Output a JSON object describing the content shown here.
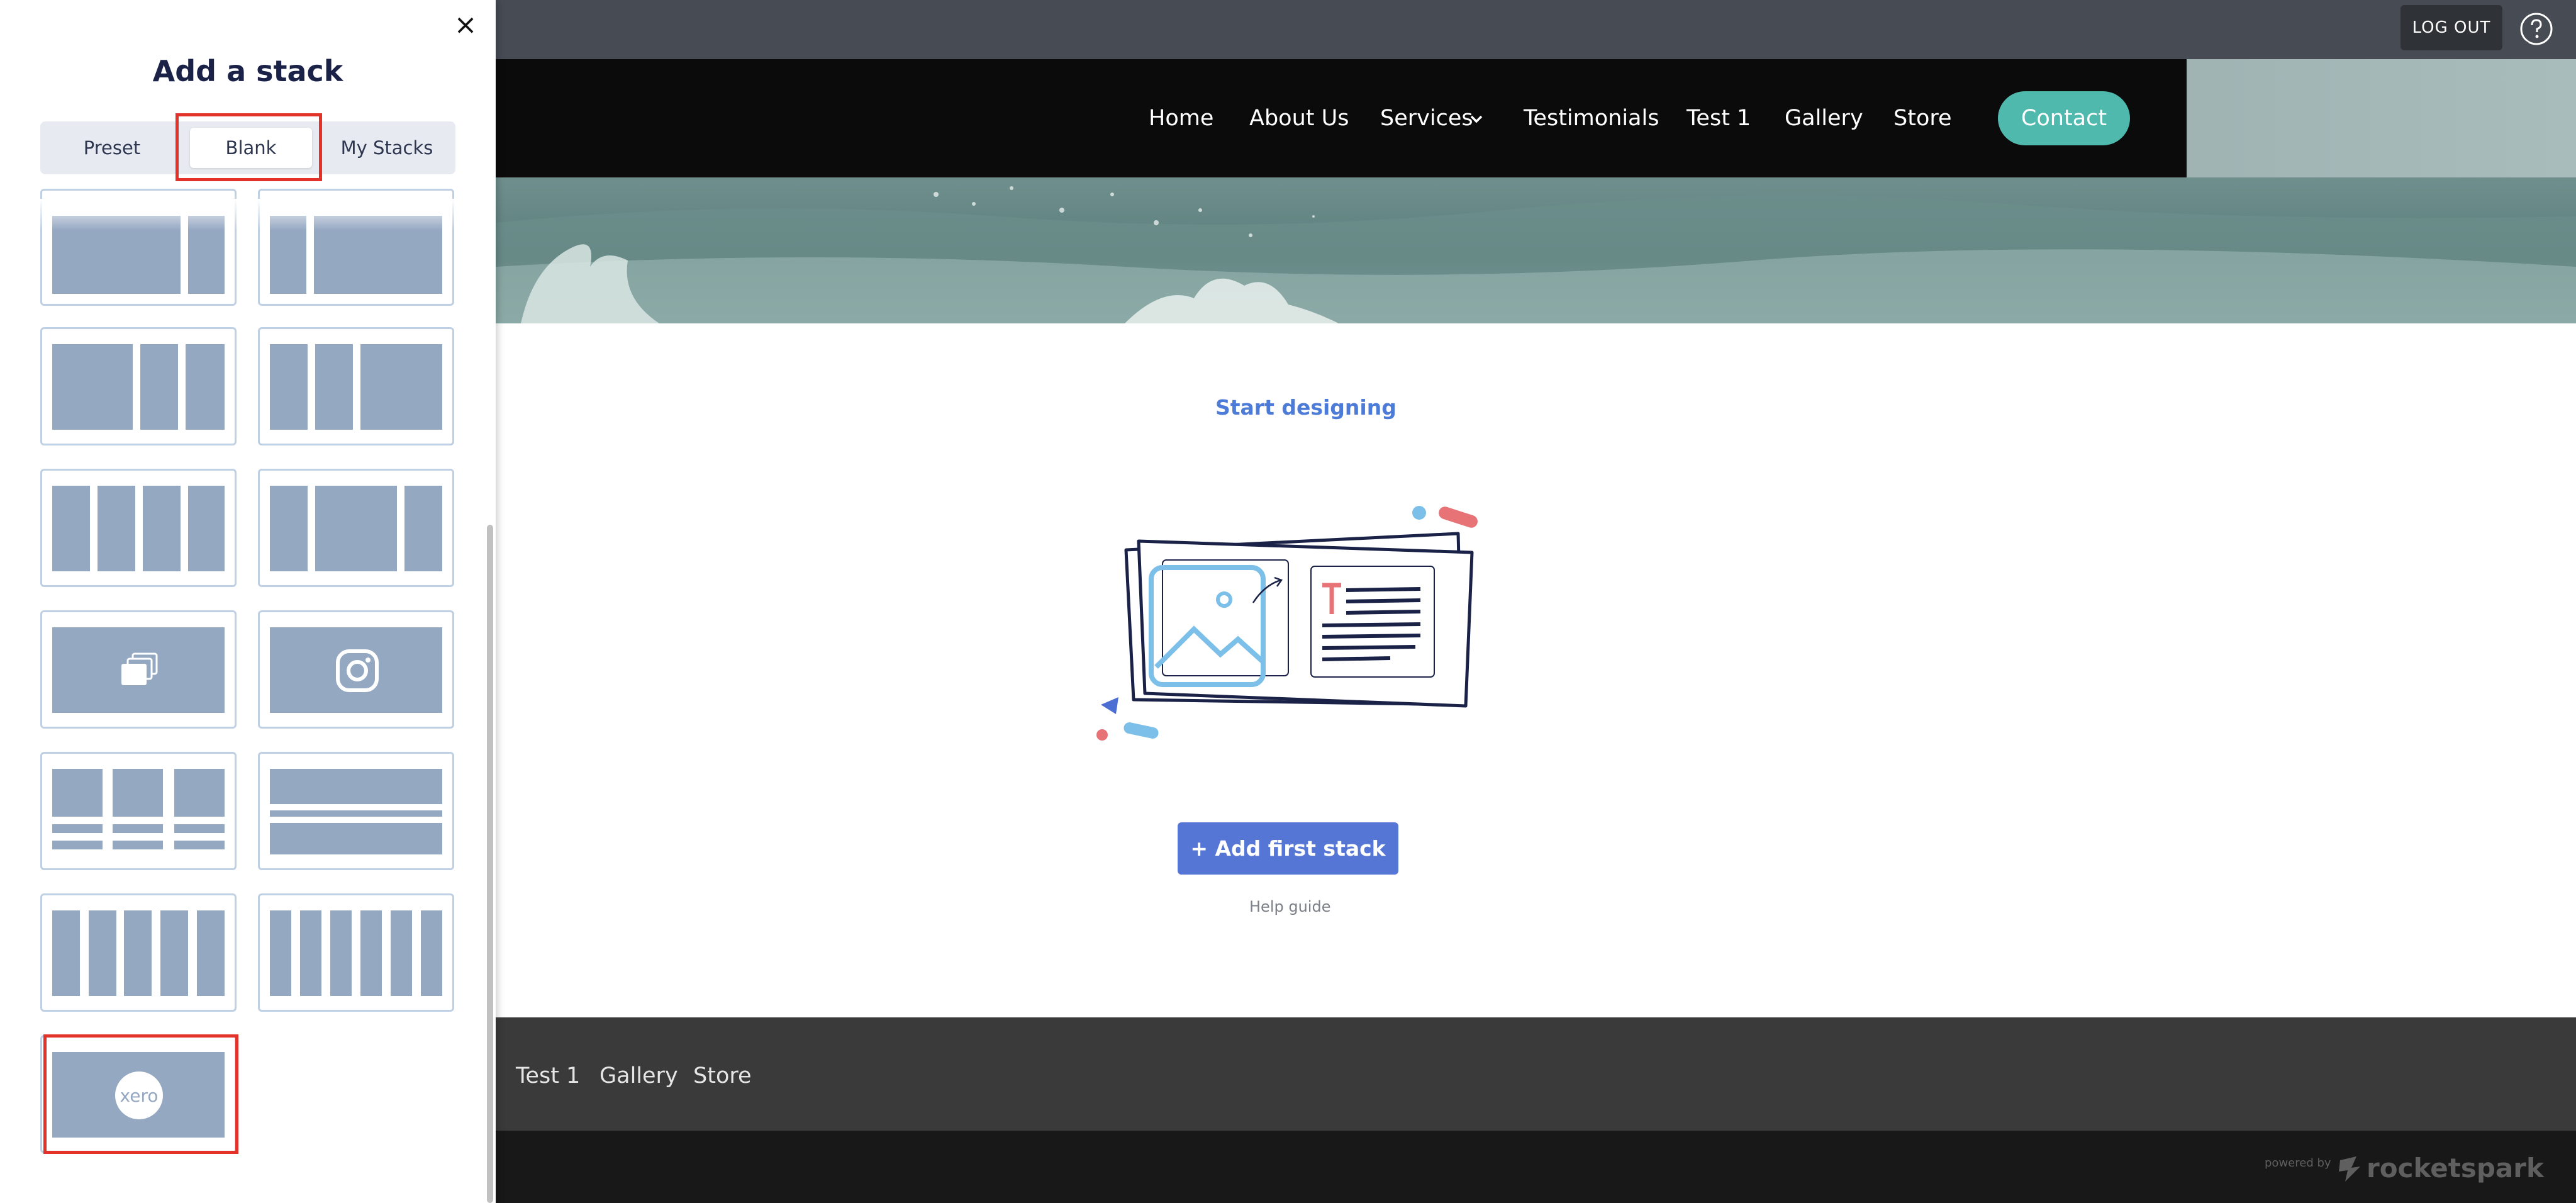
{
  "admin_bar": {
    "logout": "LOG OUT"
  },
  "site_nav": {
    "items": [
      "Home",
      "About Us",
      "Services",
      "Testimonials",
      "Test 1",
      "Gallery",
      "Store"
    ],
    "contact": "Contact"
  },
  "main": {
    "heading": "Start designing",
    "add_first_stack": "+ Add first stack",
    "help_guide": "Help guide"
  },
  "footer": {
    "items": [
      "Test 1",
      "Gallery",
      "Store"
    ],
    "powered_by": "powered by",
    "brand": "rocketspark"
  },
  "panel": {
    "title": "Add a stack",
    "close_icon": "close-icon",
    "tabs": [
      "Preset",
      "Blank",
      "My Stacks"
    ],
    "active_tab": "Blank",
    "xero_label": "xero"
  },
  "colors": {
    "admin_bar": "#474b53",
    "contact_button": "#4fb9ad",
    "primary_button": "#5676d6",
    "highlight": "#e2322a",
    "tile_block": "#95a8c2"
  }
}
